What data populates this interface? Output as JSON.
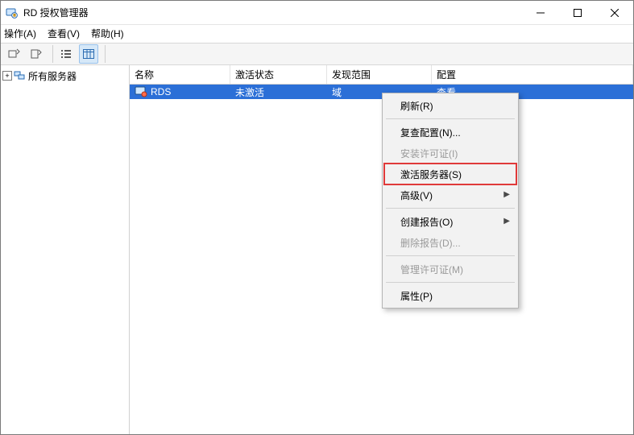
{
  "window": {
    "title": "RD 授权管理器"
  },
  "menus": {
    "action": "操作(A)",
    "view": "查看(V)",
    "help": "帮助(H)"
  },
  "tree": {
    "root": "所有服务器"
  },
  "columns": {
    "name": "名称",
    "activation": "激活状态",
    "scope": "发现范围",
    "config": "配置"
  },
  "rows": [
    {
      "name": "RDS",
      "activation": "未激活",
      "scope": "域",
      "config": "查看"
    }
  ],
  "contextMenu": {
    "refresh": "刷新(R)",
    "reviewConfig": "复查配置(N)...",
    "installLic": "安装许可证(I)",
    "activateSrv": "激活服务器(S)",
    "advanced": "高级(V)",
    "createReport": "创建报告(O)",
    "deleteReport": "删除报告(D)...",
    "manageLic": "管理许可证(M)",
    "properties": "属性(P)"
  },
  "colors": {
    "selection": "#2b6fd7",
    "highlightBox": "#e03a3a"
  }
}
